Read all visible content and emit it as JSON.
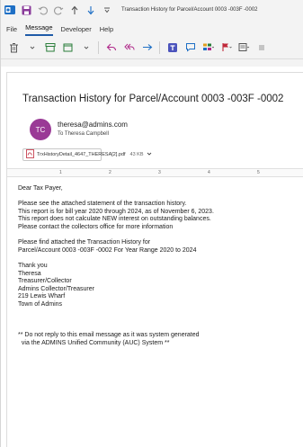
{
  "window": {
    "title": "Transaction History for Parcel/Account 0003   -003F   -0002"
  },
  "menu": {
    "items": [
      {
        "label": "File",
        "active": false
      },
      {
        "label": "Message",
        "active": true
      },
      {
        "label": "Developer",
        "active": false
      },
      {
        "label": "Help",
        "active": false
      }
    ]
  },
  "ribbon": {
    "icons": [
      "delete-icon",
      "archive-icon",
      "move-icon",
      "reply-icon",
      "reply-all-icon",
      "forward-icon",
      "teams-icon",
      "quick-steps-icon",
      "apps-icon",
      "flag-icon",
      "tags-icon"
    ]
  },
  "message": {
    "subject": "Transaction History for Parcel/Account 0003   -003F   -0002",
    "avatar_initials": "TC",
    "avatar_color": "#9a3a96",
    "sender": "theresa@admins.com",
    "to_label": "To",
    "to_name": "Theresa Campbell",
    "attachment": {
      "name": "TrxHistoryDetail_4647_THERESA[2].pdf",
      "size": "43 KB"
    }
  },
  "ruler": {
    "marks": [
      "1",
      "2",
      "3",
      "4",
      "5"
    ]
  },
  "body": {
    "greeting": "Dear Tax Payer,",
    "para1": [
      "Please see the attached statement of the transaction history.",
      "This report is for bill year 2020 through 2024, as of November 6, 2023.",
      "This report does not calculate NEW interest on outstanding balances.",
      "Please contact the collectors office for more information"
    ],
    "para2": [
      "Please find attached the Transaction History for",
      "Parcel/Account 0003   -003F   -0002 For Year Range 2020 to 2024"
    ],
    "signature": [
      "Thank you",
      "Theresa",
      "Treasurer/Collector",
      "Admins Collector/Treasurer",
      "219 Lewis Wharf",
      "Town of Admins"
    ],
    "footer": [
      "** Do not reply to this email message as it was system generated",
      "  via the ADMINS Unified Community (AUC) System **"
    ]
  }
}
